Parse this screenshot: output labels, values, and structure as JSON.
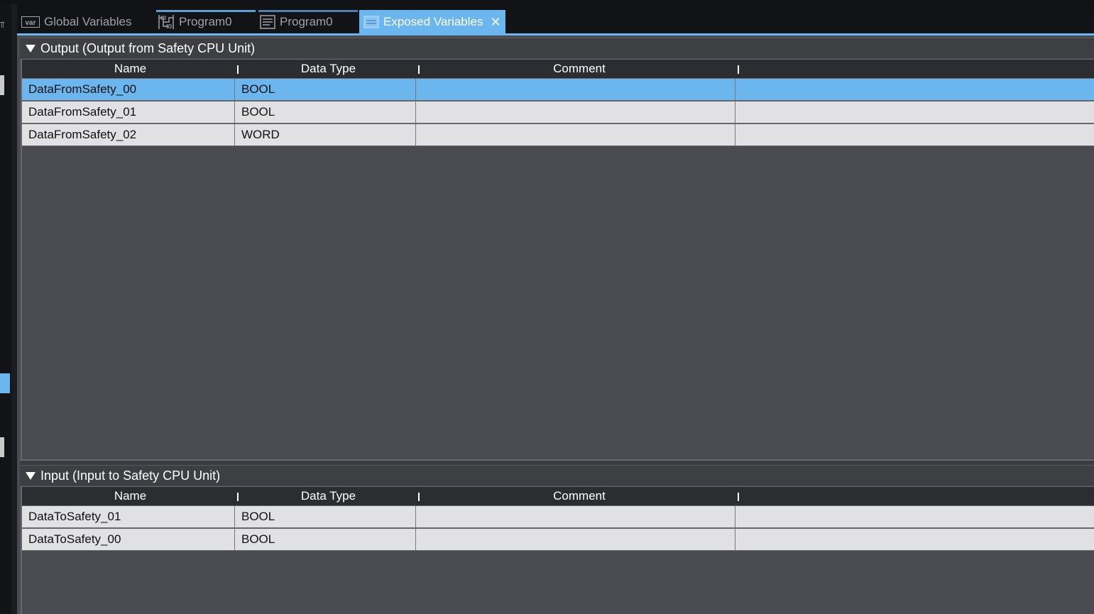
{
  "tabs": [
    {
      "label": "Global Variables",
      "icon": "var-icon"
    },
    {
      "label": "Program0",
      "icon": "ladder-icon"
    },
    {
      "label": "Program0",
      "icon": "document-icon"
    },
    {
      "label": "Exposed Variables",
      "icon": "exposed-variables-icon",
      "active": true
    }
  ],
  "columns": {
    "name": "Name",
    "data_type": "Data Type",
    "comment": "Comment"
  },
  "output": {
    "title": "Output (Output from Safety CPU Unit)",
    "rows": [
      {
        "name": "DataFromSafety_00",
        "data_type": "BOOL",
        "comment": ""
      },
      {
        "name": "DataFromSafety_01",
        "data_type": "BOOL",
        "comment": ""
      },
      {
        "name": "DataFromSafety_02",
        "data_type": "WORD",
        "comment": ""
      }
    ]
  },
  "input": {
    "title": "Input (Input to Safety CPU Unit)",
    "rows": [
      {
        "name": "DataToSafety_01",
        "data_type": "BOOL",
        "comment": ""
      },
      {
        "name": "DataToSafety_00",
        "data_type": "BOOL",
        "comment": ""
      }
    ]
  },
  "colors": {
    "accent": "#6cb6f0",
    "background": "#4a4b50",
    "row": "#e1e1e3",
    "header": "#2c2d31"
  }
}
